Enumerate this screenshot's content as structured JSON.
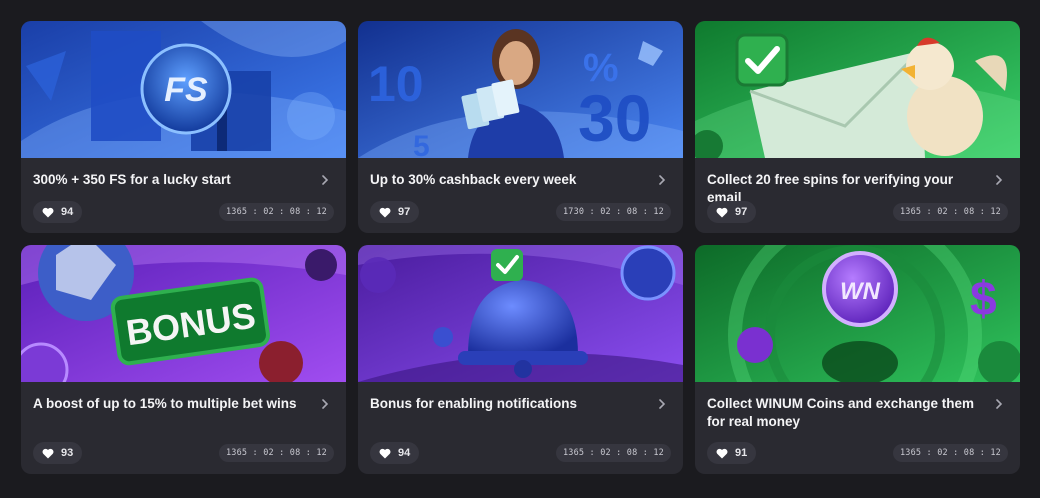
{
  "promotions": [
    {
      "title": "300% + 350 FS for a lucky start",
      "likes": "94",
      "timer": "1365 : 02 : 08 : 12",
      "banner_theme": "blue-gifts",
      "banner_text": "FS",
      "colors": {
        "bg1": "#1a3fa8",
        "bg2": "#3f7df0"
      }
    },
    {
      "title": "Up to 30% cashback every week",
      "likes": "97",
      "timer": "1730 : 02 : 08 : 12",
      "banner_theme": "blue-cashback",
      "banner_text": "30",
      "colors": {
        "bg1": "#12308f",
        "bg2": "#4a86f2"
      }
    },
    {
      "title": "Collect 20 free spins for verifying your email",
      "likes": "97",
      "timer": "1365 : 02 : 08 : 12",
      "banner_theme": "green-envelope",
      "banner_text": "",
      "colors": {
        "bg1": "#0f7a2e",
        "bg2": "#3ad06a"
      }
    },
    {
      "title": "A boost of up to 15% to multiple bet wins",
      "likes": "93",
      "timer": "1365 : 02 : 08 : 12",
      "banner_theme": "purple-bonus",
      "banner_text": "BONUS",
      "colors": {
        "bg1": "#5a1fb8",
        "bg2": "#a04df0"
      }
    },
    {
      "title": "Bonus for enabling notifications",
      "likes": "94",
      "timer": "1365 : 02 : 08 : 12",
      "banner_theme": "purple-bell",
      "banner_text": "",
      "colors": {
        "bg1": "#4a1c9e",
        "bg2": "#8b4ef0"
      }
    },
    {
      "title": "Collect WINUM Coins and exchange them for real money",
      "likes": "91",
      "timer": "1365 : 02 : 08 : 12",
      "banner_theme": "green-coins",
      "banner_text": "",
      "colors": {
        "bg1": "#0d6a28",
        "bg2": "#2fc25c"
      }
    }
  ],
  "icons": {
    "like": "heart-icon",
    "open": "chevron-right-icon"
  }
}
